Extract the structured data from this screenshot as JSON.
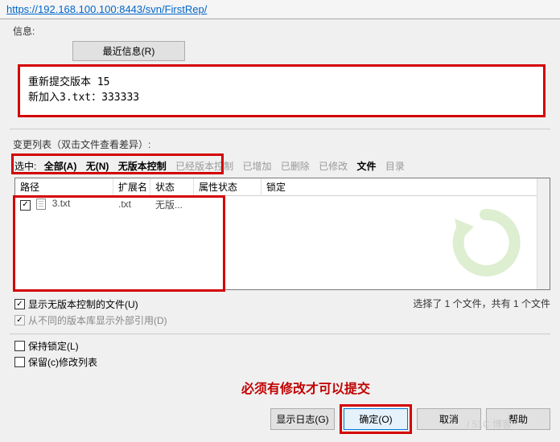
{
  "url": "https://192.168.100.100:8443/svn/FirstRep/",
  "info": {
    "group_label": "信息:",
    "recent_btn": "最近信息(R)",
    "message": "重新提交版本 15\n新加入3.txt：333333"
  },
  "changes": {
    "group_label": "变更列表（双击文件查看差异）:",
    "select_label": "选中:",
    "filters": {
      "all": "全部(A)",
      "none": "无(N)",
      "unversioned": "无版本控制",
      "versioned": "已经版本控制",
      "added": "已增加",
      "deleted": "已删除",
      "modified": "已修改",
      "files": "文件",
      "dirs": "目录"
    },
    "columns": {
      "path": "路径",
      "ext": "扩展名",
      "status": "状态",
      "pstatus": "属性状态",
      "lock": "锁定"
    },
    "rows": [
      {
        "checked": true,
        "name": "3.txt",
        "ext": ".txt",
        "status": "无版...",
        "pstatus": "",
        "lock": ""
      }
    ]
  },
  "options": {
    "show_unversioned": "显示无版本控制的文件(U)",
    "show_externals": "从不同的版本库显示外部引用(D)",
    "keep_locks": "保持锁定(L)",
    "keep_changelist": "保留(c)修改列表"
  },
  "status_text": "选择了 1 个文件，共有 1 个文件",
  "annotation": "必须有修改才可以提交",
  "buttons": {
    "log": "显示日志(G)",
    "ok": "确定(O)",
    "cancel": "取消",
    "help": "帮助"
  },
  "watermark": "/ 51C 博客"
}
